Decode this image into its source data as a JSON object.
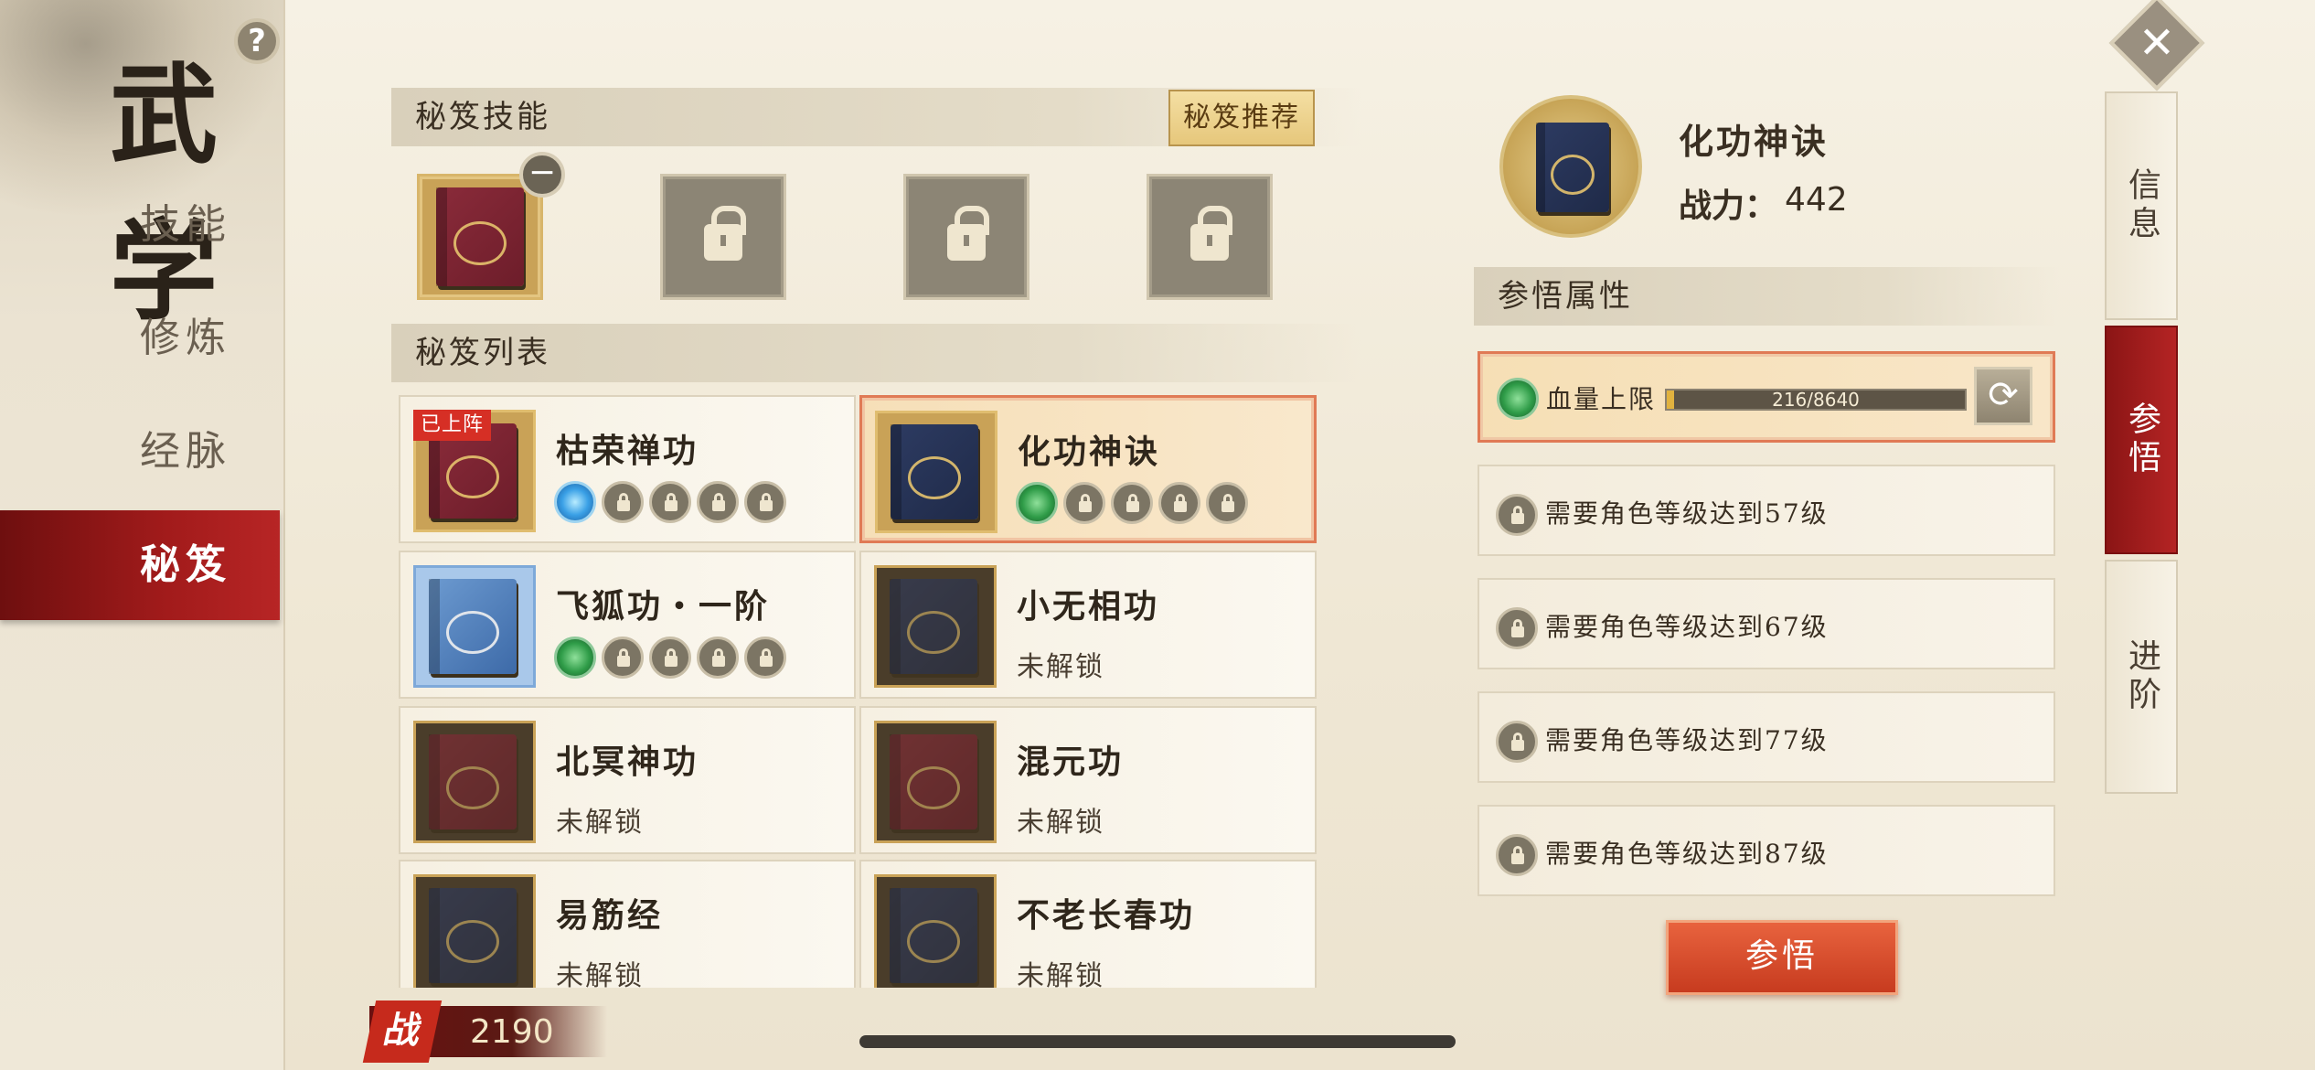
{
  "sidebar": {
    "title": "武 学",
    "help": "?",
    "items": [
      {
        "label": "技能",
        "active": false
      },
      {
        "label": "修炼",
        "active": false
      },
      {
        "label": "经脉",
        "active": false
      },
      {
        "label": "秘笈",
        "active": true
      }
    ]
  },
  "skills_section": {
    "title": "秘笈技能",
    "recommend_label": "秘笈推荐",
    "slots": [
      {
        "state": "equipped",
        "color": "red"
      },
      {
        "state": "locked"
      },
      {
        "state": "locked"
      },
      {
        "state": "locked"
      }
    ]
  },
  "list_section": {
    "title": "秘笈列表",
    "items": [
      {
        "name": "枯荣禅功",
        "badge": "已上阵",
        "book": "red",
        "gems": [
          "blue",
          "lock",
          "lock",
          "lock",
          "lock"
        ],
        "selected": false
      },
      {
        "name": "化功神诀",
        "book": "navy",
        "gems": [
          "green",
          "lock",
          "lock",
          "lock",
          "lock"
        ],
        "selected": true
      },
      {
        "name": "飞狐功・一阶",
        "book": "sky",
        "gems": [
          "green",
          "lock",
          "lock",
          "lock",
          "lock"
        ],
        "selected": false
      },
      {
        "name": "小无相功",
        "status": "未解锁",
        "book": "navy",
        "selected": false
      },
      {
        "name": "北冥神功",
        "status": "未解锁",
        "book": "red",
        "selected": false
      },
      {
        "name": "混元功",
        "status": "未解锁",
        "book": "red",
        "selected": false
      },
      {
        "name": "易筋经",
        "status": "未解锁",
        "book": "navy",
        "selected": false
      },
      {
        "name": "不老长春功",
        "status": "未解锁",
        "book": "navy",
        "selected": false
      }
    ]
  },
  "detail": {
    "name": "化功神诀",
    "power_label": "战力：",
    "power_value": "442",
    "attr_section_title": "参悟属性",
    "attributes": [
      {
        "label": "血量上限",
        "progress_text": "216/8640",
        "current": 216,
        "max": 8640,
        "unlocked": true
      },
      {
        "label": "需要角色等级达到57级",
        "unlocked": false
      },
      {
        "label": "需要角色等级达到67级",
        "unlocked": false
      },
      {
        "label": "需要角色等级达到77级",
        "unlocked": false
      },
      {
        "label": "需要角色等级达到87级",
        "unlocked": false
      }
    ],
    "action_label": "参悟"
  },
  "right_tabs": [
    {
      "label": "信息",
      "active": false
    },
    {
      "label": "参悟",
      "active": true
    },
    {
      "label": "进阶",
      "active": false
    }
  ],
  "close_icon": "✕",
  "bottom": {
    "power_icon_text": "战",
    "power_value": "2190"
  },
  "colors": {
    "accent_red": "#b42424",
    "selected_border": "#e07a55",
    "action_button": "#d9502e"
  }
}
